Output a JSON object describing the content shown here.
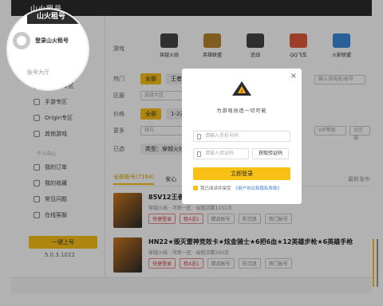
{
  "app": {
    "logo_text": "山火租号",
    "version": "5.0.3.1022"
  },
  "sidebar": {
    "section_title": "账号大厅",
    "items": [
      {
        "label": "Steam专区"
      },
      {
        "label": "手游专区"
      },
      {
        "label": "Origin专区"
      },
      {
        "label": "其他游戏"
      }
    ],
    "personal_center": "个人中心",
    "personal_items": [
      {
        "label": "我的订单"
      },
      {
        "label": "我的收藏"
      },
      {
        "label": "常见问题"
      },
      {
        "label": "在线客服"
      }
    ],
    "one_key_button": "一键上号"
  },
  "filters": {
    "game_label": "游戏",
    "games": [
      "穿越火线",
      "英雄联盟",
      "逆战",
      "QQ飞车",
      "火影联盟"
    ],
    "hot_label": "热门",
    "hot_all": "全部",
    "hot_king": "王者",
    "region_label": "区服",
    "region_placeholder": "选择大区",
    "price_label": "价格",
    "price_all": "全部",
    "price_range": "1-2元",
    "more_label": "更多",
    "sort_label": "排位",
    "selected_label": "已选",
    "selected_value": "类型：穿越火线",
    "vip_placeholder": "VIP等级",
    "all_area_placeholder": "全区服",
    "search_placeholder": "输入游戏名/账号"
  },
  "tabs": {
    "all": "全部账号(7164)",
    "safe": "安心",
    "newest": "最新发布"
  },
  "listings": [
    {
      "title": "85V12王者5套",
      "meta": "穿越火线 · 河南一区 · 出租次数1151次",
      "tags": [
        "快捷登录",
        "租4送1",
        "精品账号",
        "防沉迷",
        "热门账号"
      ]
    },
    {
      "title": "HN22★毁灭雷神竞效卡★炫金骑士★6把6血★12英雄步枪★6英雄手枪",
      "meta": "穿越火线 · 河南一区 · 出租次数293次",
      "tags": [
        "快捷登录",
        "租4送1",
        "精品账号",
        "防沉迷",
        "热门账号"
      ]
    }
  ],
  "modal": {
    "close_glyph": "×",
    "slogan": "为游戏创造一切可能",
    "phone_placeholder": "请输入手机号码",
    "code_placeholder": "请输入验证码",
    "get_code": "获取验证码",
    "login_button": "立即登录",
    "agree_prefix": "我已阅读并接受",
    "agree_link": "《用户协议和隐私条款》"
  },
  "spotlight": {
    "login_text": "登录山火租号"
  },
  "colors": {
    "accent": "#f9c116",
    "dark": "#2c2c2c"
  }
}
